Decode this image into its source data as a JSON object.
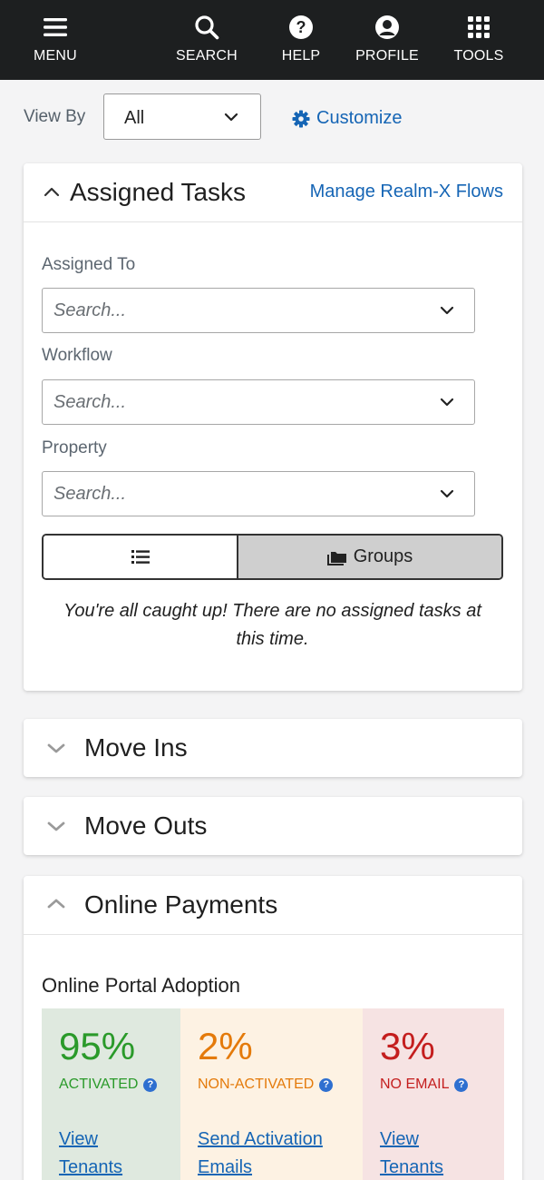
{
  "nav": {
    "menu": "MENU",
    "search": "SEARCH",
    "help": "HELP",
    "profile": "PROFILE",
    "tools": "TOOLS"
  },
  "view_by": {
    "label": "View By",
    "value": "All",
    "customize": "Customize"
  },
  "assigned_tasks": {
    "title": "Assigned Tasks",
    "manage_link": "Manage Realm-X Flows",
    "assigned_to_label": "Assigned To",
    "assigned_to_placeholder": "Search...",
    "workflow_label": "Workflow",
    "workflow_placeholder": "Search...",
    "property_label": "Property",
    "property_placeholder": "Search...",
    "groups_label": "Groups",
    "empty_line1": "You're all caught up! There are no assigned tasks at",
    "empty_line2": "this time."
  },
  "move_ins": {
    "title": "Move Ins"
  },
  "move_outs": {
    "title": "Move Outs"
  },
  "online_payments": {
    "title": "Online Payments",
    "subtitle": "Online Portal Adoption",
    "stats": [
      {
        "percent": "95%",
        "status": "ACTIVATED",
        "link_line1": "View",
        "link_line2": "Tenants",
        "color": "#2a9a2a",
        "bg": "#dfe9df"
      },
      {
        "percent": "2%",
        "status": "NON-ACTIVATED",
        "link_line1": "Send Activation",
        "link_line2": "Emails",
        "color": "#e47a0a",
        "bg": "#fdf2e3"
      },
      {
        "percent": "3%",
        "status": "NO EMAIL",
        "link_line1": "View",
        "link_line2": "Tenants",
        "color": "#c41e1e",
        "bg": "#f6e3e3"
      }
    ]
  },
  "colors": {
    "accent": "#1565b5",
    "nav_bg": "#1d1f20"
  }
}
